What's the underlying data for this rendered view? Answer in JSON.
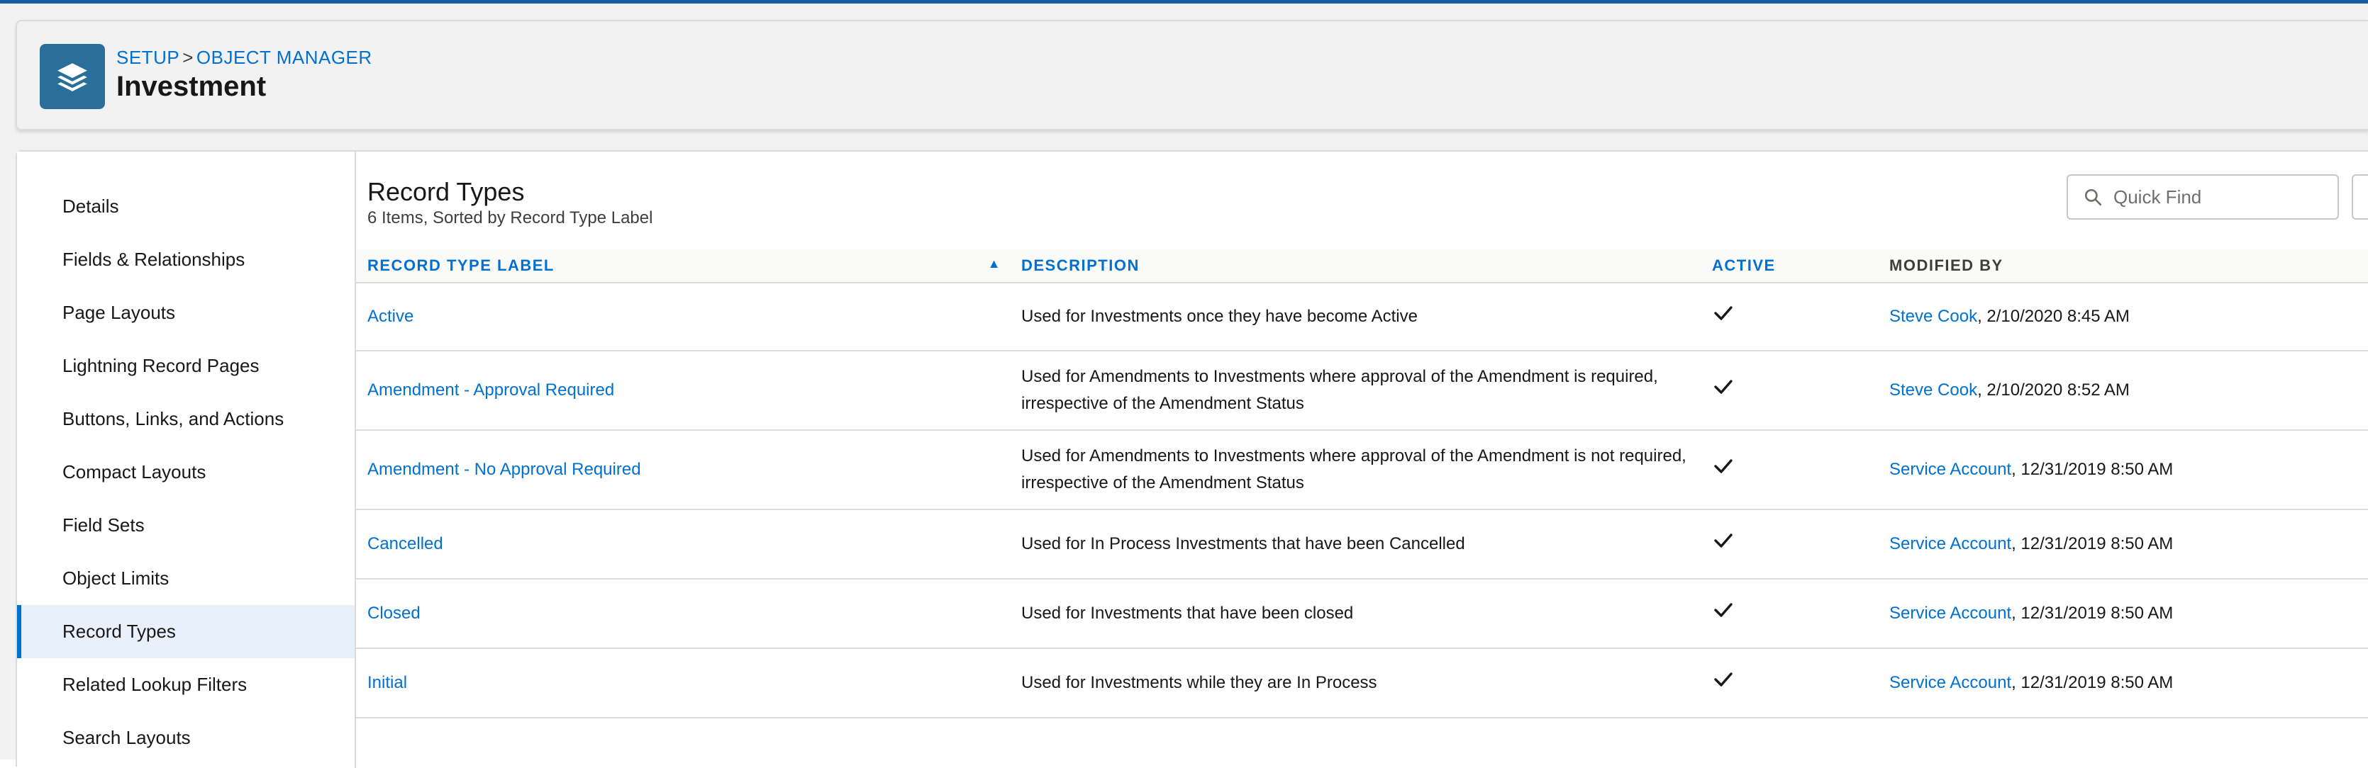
{
  "header": {
    "breadcrumb_setup": "SETUP",
    "breadcrumb_sep": ">",
    "breadcrumb_object_manager": "OBJECT MANAGER",
    "title": "Investment",
    "icon": "layers-icon"
  },
  "sidebar": {
    "items": [
      {
        "label": "Details",
        "active": false
      },
      {
        "label": "Fields & Relationships",
        "active": false
      },
      {
        "label": "Page Layouts",
        "active": false
      },
      {
        "label": "Lightning Record Pages",
        "active": false
      },
      {
        "label": "Buttons, Links, and Actions",
        "active": false
      },
      {
        "label": "Compact Layouts",
        "active": false
      },
      {
        "label": "Field Sets",
        "active": false
      },
      {
        "label": "Object Limits",
        "active": false
      },
      {
        "label": "Record Types",
        "active": true
      },
      {
        "label": "Related Lookup Filters",
        "active": false
      },
      {
        "label": "Search Layouts",
        "active": false
      }
    ]
  },
  "section": {
    "title": "Record Types",
    "subtitle": "6 Items, Sorted by Record Type Label"
  },
  "search": {
    "placeholder": "Quick Find",
    "icon": "search-icon"
  },
  "table": {
    "columns": [
      "RECORD TYPE LABEL",
      "DESCRIPTION",
      "ACTIVE",
      "MODIFIED BY"
    ],
    "sort_indicator": "▲",
    "rows": [
      {
        "label": "Active",
        "description": "Used for Investments once they have become Active",
        "active": true,
        "modified_by": "Steve Cook",
        "modified_date": ", 2/10/2020 8:45 AM"
      },
      {
        "label": "Amendment - Approval Required",
        "description": "Used for Amendments to Investments where approval of the Amendment is required, irrespective of the Amendment Status",
        "active": true,
        "modified_by": "Steve Cook",
        "modified_date": ", 2/10/2020 8:52 AM"
      },
      {
        "label": "Amendment - No Approval Required",
        "description": "Used for Amendments to Investments where approval of the Amendment is not required, irrespective of the Amendment Status",
        "active": true,
        "modified_by": "Service Account",
        "modified_date": ", 12/31/2019 8:50 AM"
      },
      {
        "label": "Cancelled",
        "description": "Used for In Process Investments that have been Cancelled",
        "active": true,
        "modified_by": "Service Account",
        "modified_date": ", 12/31/2019 8:50 AM"
      },
      {
        "label": "Closed",
        "description": "Used for Investments that have been closed",
        "active": true,
        "modified_by": "Service Account",
        "modified_date": ", 12/31/2019 8:50 AM"
      },
      {
        "label": "Initial",
        "description": "Used for Investments while they are In Process",
        "active": true,
        "modified_by": "Service Account",
        "modified_date": ", 12/31/2019 8:50 AM"
      }
    ]
  },
  "colors": {
    "brand_link": "#0070d2",
    "object_icon_bg": "#2a6f99",
    "active_nav_bg": "#e8f1fb",
    "top_bar": "#1b5f9e"
  }
}
